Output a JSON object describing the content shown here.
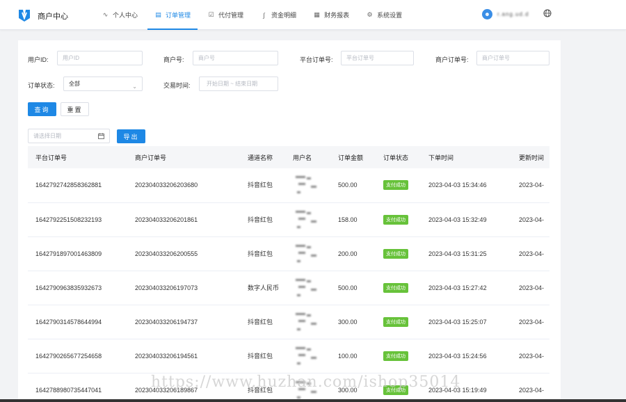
{
  "header": {
    "brand": "商户中心",
    "nav": [
      {
        "label": "个人中心",
        "icon": "user-icon"
      },
      {
        "label": "订单管理",
        "icon": "order-icon",
        "active": true
      },
      {
        "label": "代付管理",
        "icon": "payment-icon"
      },
      {
        "label": "资金明细",
        "icon": "funds-icon"
      },
      {
        "label": "财务报表",
        "icon": "report-icon"
      },
      {
        "label": "系统设置",
        "icon": "gear-icon"
      }
    ],
    "username": "r.ang.ud.d"
  },
  "filters": {
    "user_id_label": "用户ID:",
    "user_id_placeholder": "用户ID",
    "merchant_no_label": "商户号:",
    "merchant_no_placeholder": "商户号",
    "platform_order_label": "平台订单号:",
    "platform_order_placeholder": "平台订单号",
    "merchant_order_label": "商户订单号:",
    "merchant_order_placeholder": "商户订单号",
    "status_label": "订单状态:",
    "status_value": "全部",
    "time_label": "交易时间:",
    "time_placeholder": "开始日期 ~ 结束日期",
    "query_button": "查询",
    "reset_button": "重置",
    "date_placeholder": "请选择日期",
    "export_button": "导出"
  },
  "table": {
    "columns": [
      "平台订单号",
      "商户订单号",
      "通道名称",
      "用户名",
      "订单金额",
      "订单状态",
      "下单时间",
      "更新时间"
    ],
    "rows": [
      {
        "platform_order": "1642792742858362881",
        "merchant_order": "202304033206203680",
        "channel": "抖音红包",
        "amount": "500.00",
        "status": "支付成功",
        "created": "2023-04-03 15:34:46",
        "updated": "2023-04-"
      },
      {
        "platform_order": "1642792251508232193",
        "merchant_order": "202304033206201861",
        "channel": "抖音红包",
        "amount": "158.00",
        "status": "支付成功",
        "created": "2023-04-03 15:32:49",
        "updated": "2023-04-"
      },
      {
        "platform_order": "1642791897001463809",
        "merchant_order": "202304033206200555",
        "channel": "抖音红包",
        "amount": "200.00",
        "status": "支付成功",
        "created": "2023-04-03 15:31:25",
        "updated": "2023-04-"
      },
      {
        "platform_order": "1642790963835932673",
        "merchant_order": "202304033206197073",
        "channel": "数字人民币",
        "amount": "500.00",
        "status": "支付成功",
        "created": "2023-04-03 15:27:42",
        "updated": "2023-04-"
      },
      {
        "platform_order": "1642790314578644994",
        "merchant_order": "202304033206194737",
        "channel": "抖音红包",
        "amount": "300.00",
        "status": "支付成功",
        "created": "2023-04-03 15:25:07",
        "updated": "2023-04-"
      },
      {
        "platform_order": "1642790265677254658",
        "merchant_order": "202304033206194561",
        "channel": "抖音红包",
        "amount": "100.00",
        "status": "支付成功",
        "created": "2023-04-03 15:24:56",
        "updated": "2023-04-"
      },
      {
        "platform_order": "1642788980735447041",
        "merchant_order": "202304033206189867",
        "channel": "抖音红包",
        "amount": "300.00",
        "status": "支付成功",
        "created": "2023-04-03 15:19:49",
        "updated": "2023-04-"
      }
    ]
  },
  "watermark": "https://www.huzhan.com/ishop35014",
  "colors": {
    "accent": "#1e88e5",
    "success": "#67c23a"
  }
}
